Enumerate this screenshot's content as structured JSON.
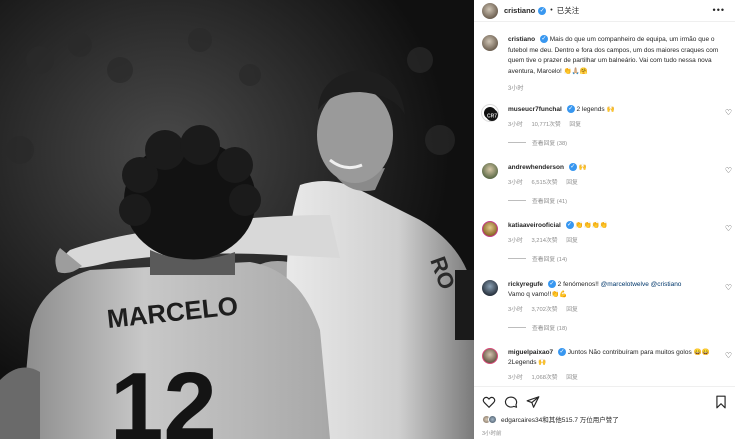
{
  "post": {
    "author": "cristiano",
    "separator": "•",
    "follow_status": "已关注",
    "more_label": "•••",
    "caption_author": "cristiano",
    "caption_text": "Mais do que um companheiro de equipa, um irmão que o futebol me deu. Dentro e fora dos campos, um dos maiores craques com quem tive o prazer de partilhar um balneário. Vai com tudo nessa nova aventura, Marcelo! 👏🙏🏼🤗",
    "caption_time": "3小时",
    "verified_glyph": "✓"
  },
  "photo": {
    "jersey_name": "MARCELO",
    "jersey_number": "12",
    "secondary_text": "RO"
  },
  "comments": [
    {
      "user": "museucr7funchal",
      "verified": true,
      "text": "2 legends 🙌",
      "time": "3小时",
      "likes": "10,771次赞",
      "reply": "回复",
      "view_replies": "查看回复 (38)",
      "avatar_color": "#1a1a1a"
    },
    {
      "user": "andrewhenderson",
      "verified": true,
      "text": "🙌",
      "time": "3小时",
      "likes": "6,515次赞",
      "reply": "回复",
      "view_replies": "查看回复 (41)",
      "avatar_color": "#7b8a6a"
    },
    {
      "user": "katiaaveirooficial",
      "verified": true,
      "text": "👏👏👏👏",
      "time": "3小时",
      "likes": "3,214次赞",
      "reply": "回复",
      "view_replies": "查看回复 (14)",
      "avatar_color": "#c9a24a"
    },
    {
      "user": "rickyregufe",
      "verified": true,
      "text_prefix": "2 fenómenos!! ",
      "mention1": "@marcelotwelve",
      "mention2": "@cristiano",
      "text2": "Vamo q vamo!!👏💪",
      "time": "3小时",
      "likes": "3,702次赞",
      "reply": "回复",
      "view_replies": "查看回复 (18)",
      "avatar_color": "#2f3a44"
    },
    {
      "user": "miguelpaixao7",
      "verified": true,
      "text": "Juntos Não contribuíram para muitos golos 😄😄 2Legends 🙌",
      "time": "3小时",
      "likes": "1,068次赞",
      "reply": "回复",
      "avatar_color": "#8f7e6a"
    }
  ],
  "actions": {
    "like_icon": "heart-icon",
    "comment_icon": "comment-icon",
    "share_icon": "send-icon",
    "save_icon": "bookmark-icon"
  },
  "likes_summary": "edgarcaires34和其他515.7 万位用户赞了",
  "post_time": "3小时前"
}
